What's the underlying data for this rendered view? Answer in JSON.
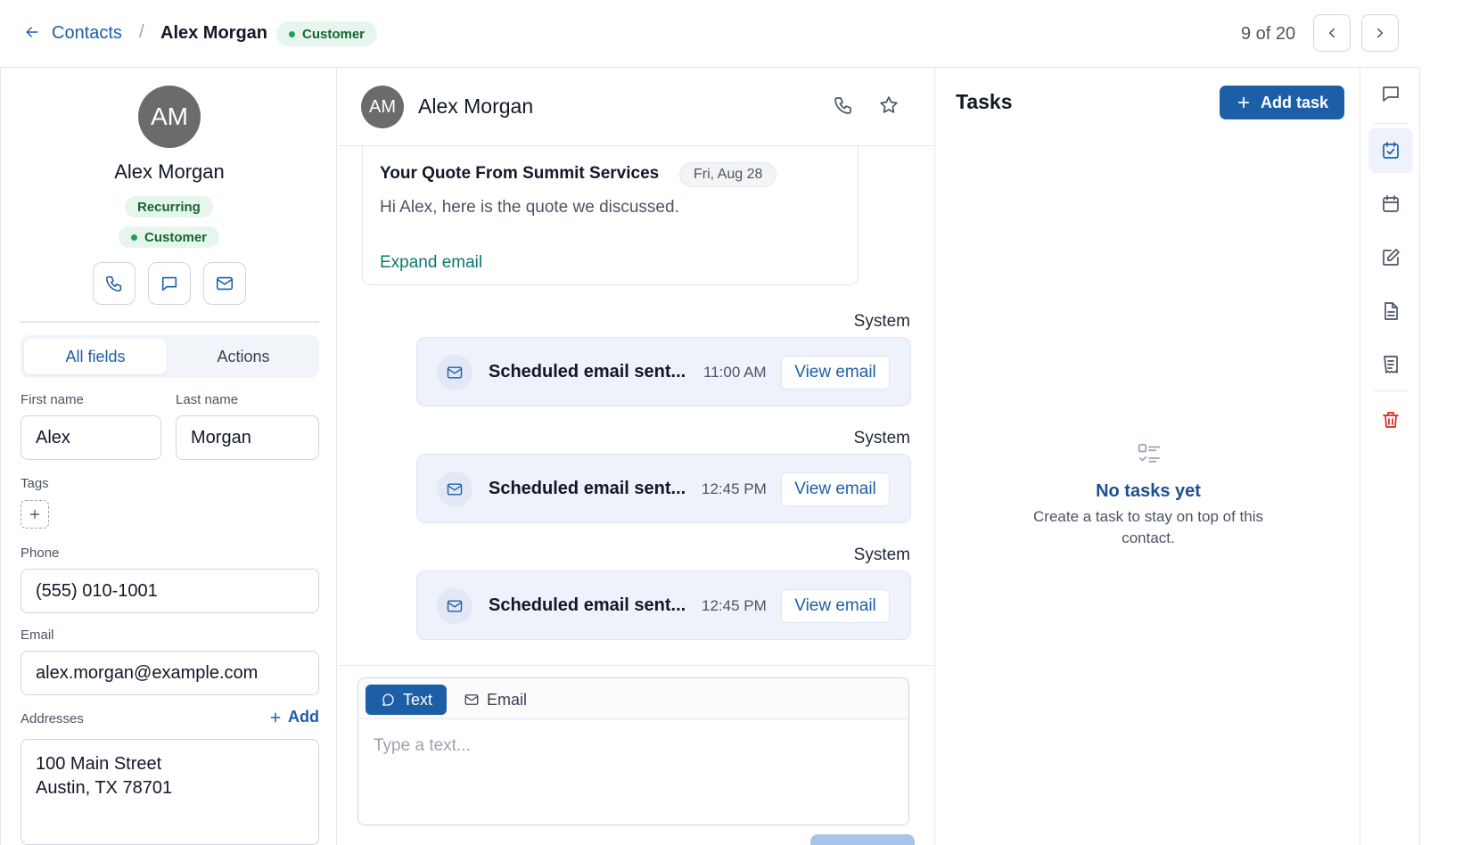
{
  "header": {
    "back_link": "Contacts",
    "separator": "/",
    "contact_name": "Alex Morgan",
    "status_badge": "Customer",
    "pager": "9 of 20"
  },
  "profile": {
    "initials": "AM",
    "name": "Alex Morgan",
    "tags": {
      "recurring": "Recurring",
      "customer": "Customer"
    },
    "tabs": {
      "all_fields": "All fields",
      "actions": "Actions"
    },
    "fields": {
      "first_name_label": "First name",
      "first_name": "Alex",
      "last_name_label": "Last name",
      "last_name": "Morgan",
      "tags_label": "Tags",
      "phone_label": "Phone",
      "phone": "(555) 010-1001",
      "email_label": "Email",
      "email": "alex.morgan@example.com",
      "addresses_label": "Addresses",
      "add_label": "Add",
      "address_line1": "100 Main Street",
      "address_line2": "Austin, TX 78701"
    }
  },
  "conversation": {
    "initials": "AM",
    "name": "Alex Morgan",
    "email_card": {
      "subject": "Your Quote From Summit Services",
      "date": "Fri, Aug 28",
      "body": "Hi Alex, here is the quote we discussed.",
      "expand": "Expand email"
    },
    "system_events": [
      {
        "sender": "System",
        "title": "Scheduled email sent...",
        "time": "11:00 AM",
        "action": "View email"
      },
      {
        "sender": "System",
        "title": "Scheduled email sent...",
        "time": "12:45 PM",
        "action": "View email"
      },
      {
        "sender": "System",
        "title": "Scheduled email sent...",
        "time": "12:45 PM",
        "action": "View email"
      }
    ],
    "composer": {
      "tab_text": "Text",
      "tab_email": "Email",
      "placeholder": "Type a text..."
    }
  },
  "tasks": {
    "title": "Tasks",
    "add_button": "Add task",
    "empty_title": "No tasks yet",
    "empty_subtitle": "Create a task to stay on top of this contact."
  },
  "rail": {
    "icons": [
      "chat-icon",
      "task-check-icon",
      "calendar-icon",
      "edit-icon",
      "document-icon",
      "invoice-icon",
      "trash-icon"
    ]
  },
  "colors": {
    "accent": "#1d5fa7",
    "success": "#166534",
    "danger": "#dc2626"
  }
}
